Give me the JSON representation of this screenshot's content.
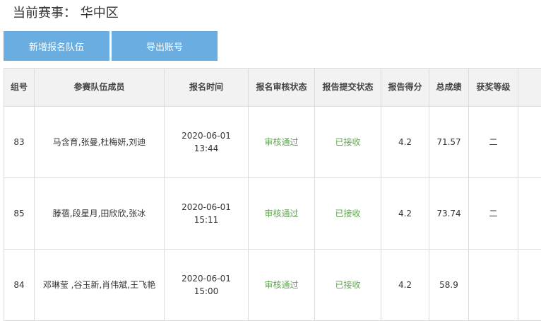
{
  "header": {
    "competition_label": "当前赛事：",
    "competition_value": "华中区"
  },
  "toolbar": {
    "add_team_label": "新增报名队伍",
    "export_label": "导出账号"
  },
  "table": {
    "columns": [
      "组号",
      "参赛队伍成员",
      "报名时间",
      "报名审核状态",
      "报告提交状态",
      "报告得分",
      "总成绩",
      "获奖等级",
      ""
    ],
    "rows": [
      {
        "group": "83",
        "members": "马含育,张曼,杜梅妍,刘迪",
        "date": "2020-06-01",
        "time": "13:44",
        "review": "审核通过",
        "submit": "已接收",
        "report_score": "4.2",
        "total": "71.57",
        "award": "二"
      },
      {
        "group": "85",
        "members": "滕蓓,段星月,田欣欣,张冰",
        "date": "2020-06-01",
        "time": "15:11",
        "review": "审核通过",
        "submit": "已接收",
        "report_score": "4.2",
        "total": "73.74",
        "award": "二"
      },
      {
        "group": "84",
        "members": "邓琳莹 ,谷玉新,肖伟斌,王飞艳",
        "date": "2020-06-01",
        "time": "15:00",
        "review": "审核通过",
        "submit": "已接收",
        "report_score": "4.2",
        "total": "58.9",
        "award": ""
      }
    ]
  },
  "colors": {
    "button_bg": "#6aade0",
    "status_green": "#5ea74d",
    "header_bg": "#f2f2f2"
  }
}
